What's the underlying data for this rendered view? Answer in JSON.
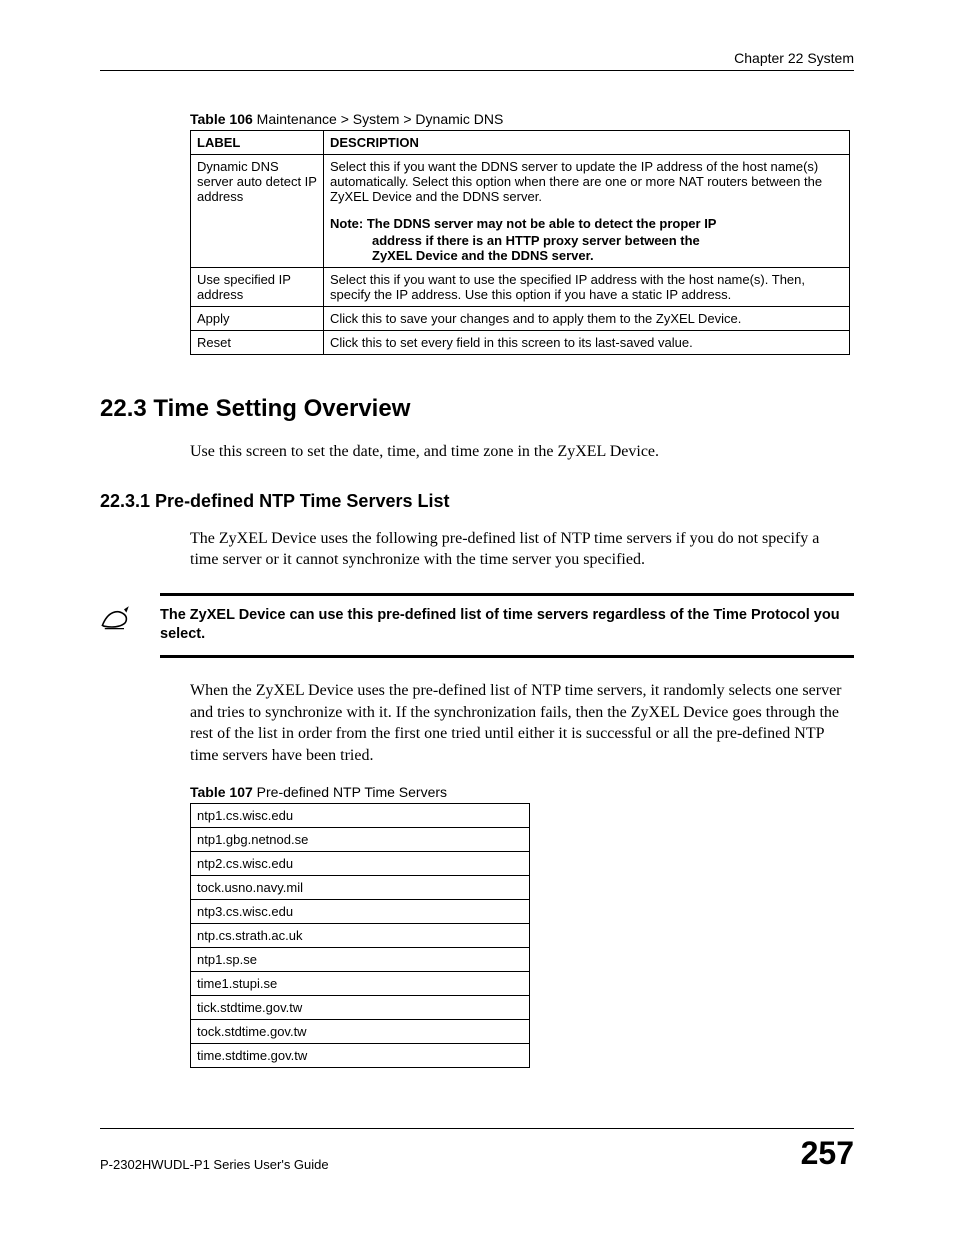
{
  "header": {
    "chapter": "Chapter 22 System"
  },
  "table106": {
    "caption_bold": "Table 106",
    "caption_rest": "   Maintenance > System > Dynamic DNS",
    "head_label": "LABEL",
    "head_desc": "DESCRIPTION",
    "rows": [
      {
        "label": "Dynamic DNS server auto detect IP address",
        "desc": "Select this if you want the DDNS server to update the IP address of the host name(s) automatically. Select this option when there are one or more NAT routers between the ZyXEL Device and the DDNS server.",
        "note_lead": "Note: The DDNS server may not be able to detect the proper IP",
        "note_line2": "address if there is an HTTP proxy server between the",
        "note_line3": "ZyXEL Device and the DDNS server."
      },
      {
        "label": "Use specified IP address",
        "desc": "Select this if you want to use the specified IP address with the host name(s). Then, specify the IP address. Use this option if you have a static IP address."
      },
      {
        "label": "Apply",
        "desc": "Click this to save your changes and to apply them to the ZyXEL Device."
      },
      {
        "label": "Reset",
        "desc": "Click this to set every field in this screen to its last-saved value."
      }
    ]
  },
  "section": {
    "title": "22.3  Time Setting Overview",
    "intro": "Use this screen to set the date, time, and time zone in the ZyXEL Device."
  },
  "subsection": {
    "title": "22.3.1  Pre-defined NTP Time Servers List",
    "p1": "The ZyXEL Device uses the following pre-defined list of NTP time servers if you do not specify a time server or it cannot synchronize with the time server you specified.",
    "callout": "The ZyXEL Device can use this pre-defined list of time servers regardless of the Time Protocol you select.",
    "p2": "When the ZyXEL Device uses the pre-defined list of NTP time servers, it randomly selects one server and tries to synchronize with it. If the synchronization fails, then the ZyXEL Device goes through the rest of the list in order from the first one tried until either it is successful or all the pre-defined NTP time servers have been tried."
  },
  "table107": {
    "caption_bold": "Table 107",
    "caption_rest": "   Pre-defined NTP Time Servers",
    "servers": [
      "ntp1.cs.wisc.edu",
      "ntp1.gbg.netnod.se",
      "ntp2.cs.wisc.edu",
      "tock.usno.navy.mil",
      "ntp3.cs.wisc.edu",
      "ntp.cs.strath.ac.uk",
      "ntp1.sp.se",
      "time1.stupi.se",
      "tick.stdtime.gov.tw",
      "tock.stdtime.gov.tw",
      "time.stdtime.gov.tw"
    ]
  },
  "footer": {
    "guide": "P-2302HWUDL-P1 Series User's Guide",
    "page": "257"
  }
}
